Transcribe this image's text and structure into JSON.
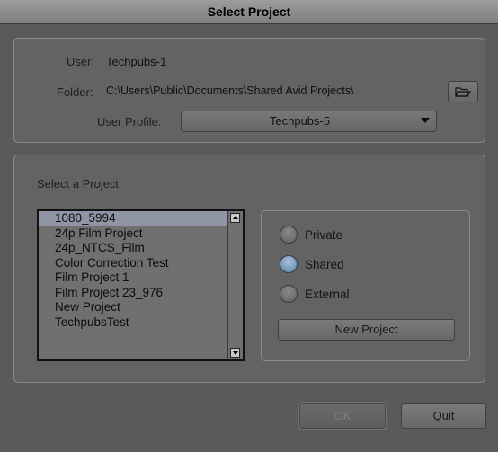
{
  "window": {
    "title": "Select Project"
  },
  "top_panel": {
    "user_label": "User:",
    "user_value": "Techpubs-1",
    "folder_label": "Folder:",
    "folder_value": "C:\\Users\\Public\\Documents\\Shared Avid Projects\\",
    "folder_button_icon": "folder-browse-icon",
    "profile_label": "User Profile:",
    "profile_value": "Techpubs-5"
  },
  "projects": {
    "label": "Select a Project:",
    "items": [
      "1080_5994",
      "24p Film Project",
      "24p_NTCS_Film",
      "Color Correction Test",
      "Film Project 1",
      "Film Project 23_976",
      "New Project",
      "TechpubsTest"
    ],
    "selected": "1080_5994"
  },
  "project_type": {
    "options": [
      "Private",
      "Shared",
      "External"
    ],
    "selected": "Shared",
    "new_project_label": "New Project"
  },
  "buttons": {
    "ok_label": "OK",
    "quit_label": "Quit"
  },
  "colors": {
    "background": "#5a5a5a",
    "selection": "#8f95a4",
    "radio_checked": "#7093bd"
  }
}
